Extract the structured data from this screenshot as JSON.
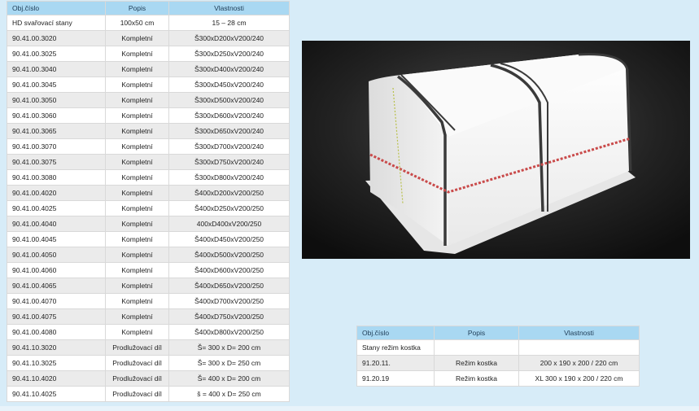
{
  "main_table": {
    "headers": [
      "Obj.číslo",
      "Popis",
      "Vlastnosti"
    ],
    "rows": [
      [
        "HD svařovací stany",
        "100x50 cm",
        "15 – 28 cm"
      ],
      [
        "90.41.00.3020",
        "Kompletní",
        "Š300xD200xV200/240"
      ],
      [
        "90.41.00.3025",
        "Kompletní",
        "Š300xD250xV200/240"
      ],
      [
        "90.41.00.3040",
        "Kompletní",
        "Š300xD400xV200/240"
      ],
      [
        "90.41.00.3045",
        "Kompletní",
        "Š300xD450xV200/240"
      ],
      [
        "90.41.00.3050",
        "Kompletní",
        "Š300xD500xV200/240"
      ],
      [
        "90.41.00.3060",
        "Kompletní",
        "Š300xD600xV200/240"
      ],
      [
        "90.41.00.3065",
        "Kompletní",
        "Š300xD650xV200/240"
      ],
      [
        "90.41.00.3070",
        "Kompletní",
        "Š300xD700xV200/240"
      ],
      [
        "90.41.00.3075",
        "Kompletní",
        "Š300xD750xV200/240"
      ],
      [
        "90.41.00.3080",
        "Kompletní",
        "Š300xD800xV200/240"
      ],
      [
        "90.41.00.4020",
        "Kompletní",
        "Š400xD200xV200/250"
      ],
      [
        "90.41.00.4025",
        "Kompletní",
        "Š400xD250xV200/250"
      ],
      [
        "90.41.00.4040",
        "Kompletní",
        "400xD400xV200/250"
      ],
      [
        "90.41.00.4045",
        "Kompletní",
        "Š400xD450xV200/250"
      ],
      [
        "90.41.00.4050",
        "Kompletní",
        "Š400xD500xV200/250"
      ],
      [
        "90.41.00.4060",
        "Kompletní",
        "Š400xD600xV200/250"
      ],
      [
        "90.41.00.4065",
        "Kompletní",
        "Š400xD650xV200/250"
      ],
      [
        "90.41.00.4070",
        "Kompletní",
        "Š400xD700xV200/250"
      ],
      [
        "90.41.00.4075",
        "Kompletní",
        "Š400xD750xV200/250"
      ],
      [
        "90.41.00.4080",
        "Kompletní",
        "Š400xD800xV200/250"
      ],
      [
        "90.41.10.3020",
        "Prodlužovací díl",
        "Š= 300 x D= 200 cm"
      ],
      [
        "90.41.10.3025",
        "Prodlužovací díl",
        "Š= 300 x D= 250 cm"
      ],
      [
        "90.41.10.4020",
        "Prodlužovací díl",
        "Š= 400 x D= 200 cm"
      ],
      [
        "90.41.10.4025",
        "Prodlužovací díl",
        "š = 400 x D= 250 cm"
      ]
    ]
  },
  "second_table": {
    "headers": [
      "Obj.číslo",
      "Popis",
      "Vlastnosti"
    ],
    "rows": [
      [
        "Stany režim kostka",
        "",
        ""
      ],
      [
        "91.20.11.",
        "Režim kostka",
        "200 x 190 x 200 / 220 cm"
      ],
      [
        "91.20.19",
        "Režim kostka",
        "XL 300 x 190 x 200 / 220 cm"
      ]
    ]
  },
  "image": {
    "subject": "welding-tent-product-photo",
    "colors": {
      "background": "#1a1a1a",
      "tent": "#f2f2f2",
      "strap": "#3a3a3a",
      "tape": "#c94a4a"
    }
  },
  "colors": {
    "page_background": "#d7ecf8",
    "header_background": "#a9d8f2",
    "row_alt": "#ebebeb"
  }
}
